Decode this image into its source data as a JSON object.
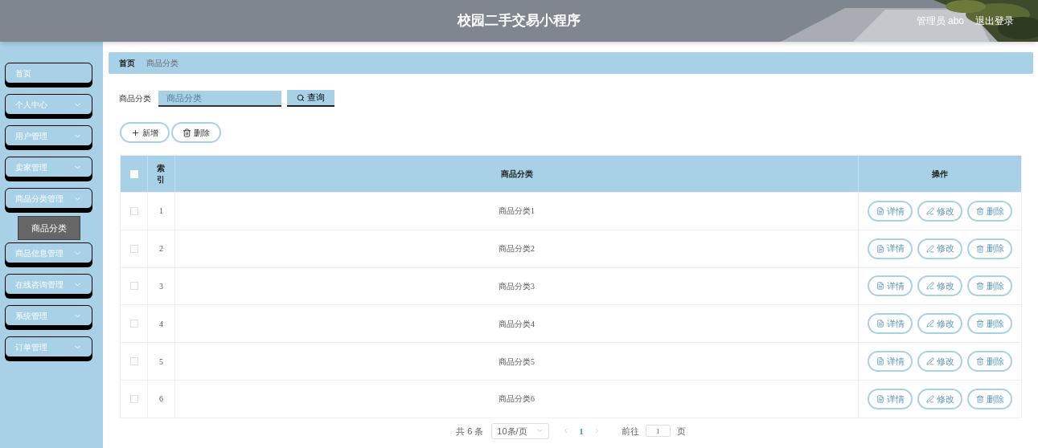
{
  "header": {
    "title": "校园二手交易小程序",
    "user": "管理员 abo",
    "logout": "退出登录"
  },
  "sidebar": {
    "items": [
      {
        "label": "首页",
        "expandable": false
      },
      {
        "label": "个人中心",
        "expandable": true
      },
      {
        "label": "用户管理",
        "expandable": true
      },
      {
        "label": "卖家管理",
        "expandable": true
      },
      {
        "label": "商品分类管理",
        "expandable": true,
        "children": [
          {
            "label": "商品分类",
            "selected": true
          }
        ]
      },
      {
        "label": "商品信息管理",
        "expandable": true
      },
      {
        "label": "在线咨询管理",
        "expandable": true
      },
      {
        "label": "系统管理",
        "expandable": true
      },
      {
        "label": "订单管理",
        "expandable": true
      }
    ]
  },
  "breadcrumb": [
    "首页",
    "商品分类"
  ],
  "search": {
    "label": "商品分类",
    "placeholder": "商品分类",
    "button": "查询"
  },
  "actions": [
    {
      "kind": "add",
      "label": "新增"
    },
    {
      "kind": "delete",
      "label": "删除"
    }
  ],
  "table": {
    "columns": [
      "索引",
      "商品分类",
      "操作"
    ],
    "all_checked": false,
    "rows": [
      {
        "index": "1",
        "name": "商品分类1",
        "checked": false,
        "actions": [
          {
            "kind": "detail",
            "label": "详情"
          },
          {
            "kind": "edit",
            "label": "修改"
          },
          {
            "kind": "delete",
            "label": "删除"
          }
        ]
      },
      {
        "index": "2",
        "name": "商品分类2",
        "checked": false,
        "actions": [
          {
            "kind": "detail",
            "label": "详情"
          },
          {
            "kind": "edit",
            "label": "修改"
          },
          {
            "kind": "delete",
            "label": "删除"
          }
        ]
      },
      {
        "index": "3",
        "name": "商品分类3",
        "checked": false,
        "actions": [
          {
            "kind": "detail",
            "label": "详情"
          },
          {
            "kind": "edit",
            "label": "修改"
          },
          {
            "kind": "delete",
            "label": "删除"
          }
        ]
      },
      {
        "index": "4",
        "name": "商品分类4",
        "checked": false,
        "actions": [
          {
            "kind": "detail",
            "label": "详情"
          },
          {
            "kind": "edit",
            "label": "修改"
          },
          {
            "kind": "delete",
            "label": "删除"
          }
        ]
      },
      {
        "index": "5",
        "name": "商品分类5",
        "checked": false,
        "actions": [
          {
            "kind": "detail",
            "label": "详情"
          },
          {
            "kind": "edit",
            "label": "修改"
          },
          {
            "kind": "delete",
            "label": "删除"
          }
        ]
      },
      {
        "index": "6",
        "name": "商品分类6",
        "checked": false,
        "actions": [
          {
            "kind": "detail",
            "label": "详情"
          },
          {
            "kind": "edit",
            "label": "修改"
          },
          {
            "kind": "delete",
            "label": "删除"
          }
        ]
      }
    ]
  },
  "pagination": {
    "total": "共 6 条",
    "page_size": "10条/页",
    "pages": [
      {
        "label": "1",
        "selected": true
      }
    ],
    "goto_label": "前往",
    "goto_value": "1",
    "goto_suffix": "页"
  }
}
